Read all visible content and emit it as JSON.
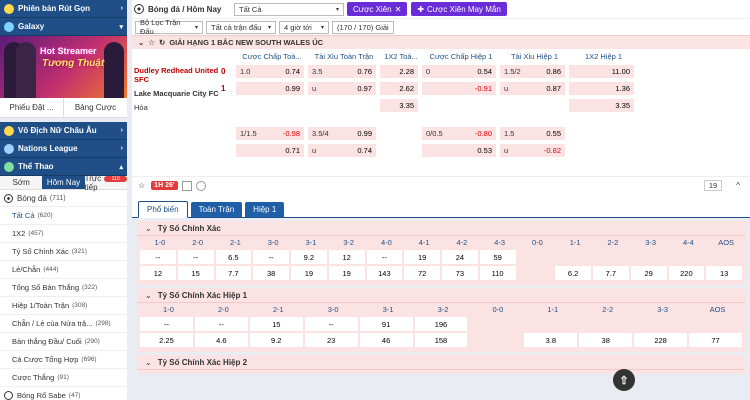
{
  "sidebar": {
    "nav1": "Phiên bản Rút Gọn",
    "nav2": "Galaxy",
    "banner_line1": "Hot Streamer",
    "banner_line2": "Tương Thuật",
    "phieu_dat": "Phiếu Đặt ...",
    "bang_cuoc": "Bảng Cược",
    "sec1": "Vô Địch Nữ Châu Âu",
    "sec2": "Nations League",
    "sec3": "Thể Thao",
    "tab_som": "Sớm",
    "tab_hom_nay": "Hôm Nay",
    "tab_truc_tiep": "Trực tiếp",
    "tab_badge": "110",
    "sport": "Bóng đá",
    "sport_count": "(711)",
    "markets": [
      {
        "label": "Tất Cả",
        "count": "(620)"
      },
      {
        "label": "1X2",
        "count": "(457)"
      },
      {
        "label": "Tỷ Số Chính Xác",
        "count": "(321)"
      },
      {
        "label": "Lẻ/Chẵn",
        "count": "(444)"
      },
      {
        "label": "Tổng Số Bàn Thắng",
        "count": "(322)"
      },
      {
        "label": "Hiệp 1/Toàn Trận",
        "count": "(308)"
      },
      {
        "label": "Chẵn / Lẻ của Nửa trậ...",
        "count": "(298)"
      },
      {
        "label": "Bàn thắng Đầu/ Cuối",
        "count": "(290)"
      },
      {
        "label": "Cá Cược Tổng Hợp",
        "count": "(696)"
      },
      {
        "label": "Cược Thắng",
        "count": "(91)"
      },
      {
        "label": "Bóng Rổ Sabe",
        "count": "(47)"
      }
    ]
  },
  "topbar": {
    "title": "Bóng đá / Hôm Nay",
    "select1": "Tất Cả",
    "btn_cuoc_xien": "Cược Xiên",
    "btn_may_man": "Cược Xiên May Mắn",
    "filter1": "Bộ Lọc Trận Đấu",
    "filter2": "Tất cả trận đấu",
    "filter3": "4 giờ tới",
    "filter4": "(170 / 170) Giải"
  },
  "league": "GIẢI HẠNG 1 BẮC NEW SOUTH WALES ÚC",
  "odds_headers": [
    "Cược Chấp Toà...",
    "Tài Xỉu Toàn Trận",
    "1X2 Toà...",
    "Cược Chấp Hiệp 1",
    "Tài Xỉu Hiệp 1",
    "1X2 Hiệp 1"
  ],
  "match": {
    "team1": "Dudley Redhead United SFC",
    "team2": "Lake Macquarie City FC",
    "draw": "Hòa",
    "score1": "0",
    "score2": "1",
    "time": "1H 26'",
    "more_count": "19"
  },
  "odds": {
    "r1": [
      [
        "1.0",
        "0.74"
      ],
      [
        "3.5",
        "0.76"
      ],
      [
        "",
        "2.28"
      ],
      [
        "0",
        "0.54"
      ],
      [
        "1.5/2",
        "0.86"
      ],
      [
        "",
        "11.00"
      ]
    ],
    "r2": [
      [
        "",
        "0.99"
      ],
      [
        "u",
        "0.97"
      ],
      [
        "",
        "2.62"
      ],
      [
        "",
        "-0.91"
      ],
      [
        "u",
        "0.87"
      ],
      [
        "",
        "1.36"
      ]
    ],
    "r3": [
      [
        "",
        "3.35"
      ],
      [
        "",
        "3.35"
      ]
    ],
    "r4": [
      [
        "1/1.5",
        "-0.98"
      ],
      [
        "3.5/4",
        "0.99"
      ],
      [
        "0/0.5",
        "-0.80"
      ],
      [
        "1.5",
        "0.55"
      ]
    ],
    "r5": [
      [
        "",
        "0.71"
      ],
      [
        "u",
        "0.74"
      ],
      [
        "",
        "0.53"
      ],
      [
        "u",
        "-0.82"
      ]
    ]
  },
  "tabs": [
    "Phổ biến",
    "Toàn Trận",
    "Hiệp 1"
  ],
  "panels": {
    "p1_title": "Tỷ Số Chính Xác",
    "p1_head": [
      "1-0",
      "2-0",
      "2-1",
      "3-0",
      "3-1",
      "3-2",
      "4-0",
      "4-1",
      "4-2",
      "4-3",
      "0-0",
      "1-1",
      "2-2",
      "3-3",
      "4-4",
      "AOS"
    ],
    "p1_r1": [
      "--",
      "--",
      "6.5",
      "--",
      "9.2",
      "12",
      "--",
      "19",
      "24",
      "59"
    ],
    "p1_r2": [
      "12",
      "15",
      "7.7",
      "38",
      "19",
      "19",
      "143",
      "72",
      "73",
      "110",
      "6.2",
      "7.7",
      "29",
      "220",
      "13"
    ],
    "p2_title": "Tỷ Số Chính Xác Hiệp 1",
    "p2_head": [
      "1-0",
      "2-0",
      "2-1",
      "3-0",
      "3-1",
      "3-2",
      "0-0",
      "1-1",
      "2-2",
      "3-3",
      "AOS"
    ],
    "p2_r1": [
      "--",
      "--",
      "15",
      "--",
      "91",
      "196"
    ],
    "p2_r2": [
      "2.25",
      "4.6",
      "9.2",
      "23",
      "46",
      "158",
      "3.8",
      "38",
      "228",
      "77"
    ],
    "p3_title": "Tỷ Số Chính Xác Hiệp 2"
  }
}
